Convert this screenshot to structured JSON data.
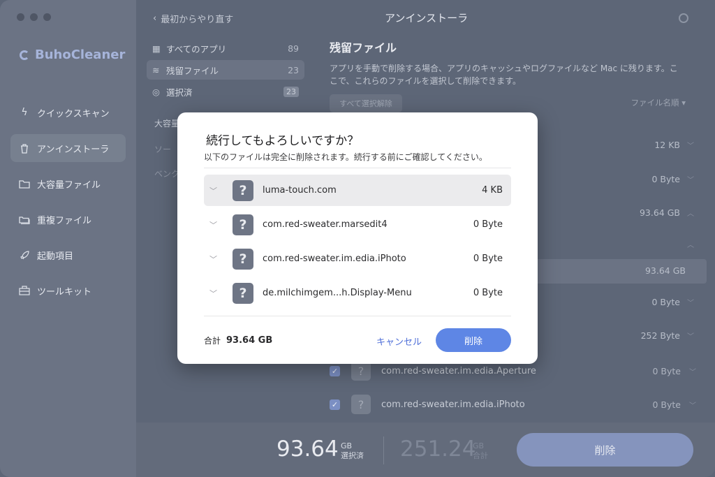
{
  "app": {
    "name": "BuhoCleaner",
    "window_title": "アンインストーラ"
  },
  "sidebar": {
    "items": [
      {
        "label": "クイックスキャン",
        "icon": "bolt-icon"
      },
      {
        "label": "アンインストーラ",
        "icon": "trash-icon",
        "active": true
      },
      {
        "label": "大容量ファイル",
        "icon": "folder-icon"
      },
      {
        "label": "重複ファイル",
        "icon": "folders-icon"
      },
      {
        "label": "起動項目",
        "icon": "rocket-icon"
      },
      {
        "label": "ツールキット",
        "icon": "toolbox-icon"
      }
    ]
  },
  "topbar": {
    "back_label": "最初からやり直す"
  },
  "categories": [
    {
      "label": "すべてのアプリ",
      "count": "89",
      "icon": "grid-icon"
    },
    {
      "label": "残留ファイル",
      "count": "23",
      "icon": "layers-icon",
      "active": true
    },
    {
      "label": "選択済",
      "count": "23",
      "icon": "check-circle-icon"
    }
  ],
  "category_section": {
    "label": "大容量",
    "faded1": "ソー",
    "faded2": "ベンク"
  },
  "right_panel": {
    "title": "残留ファイル",
    "description": "アプリを手動で削除する場合、アプリのキャッシュやログファイルなど Mac に残ります。ここで、これらのファイルを選択して削除できます。",
    "select_all_label": "すべて選択解除",
    "sort_label": "ファイル名順 ▾",
    "size_rows": [
      "12 KB",
      "0 Byte",
      "93.64 GB",
      "",
      "93.64 GB",
      "0 Byte",
      "252 Byte"
    ],
    "list_rows": [
      {
        "name": "com.red-sweater.im.edia.Aperture",
        "size": "0 Byte"
      },
      {
        "name": "com.red-sweater.im.edia.iPhoto",
        "size": "0 Byte"
      }
    ]
  },
  "bottom": {
    "selected_value": "93.64",
    "selected_unit": "GB",
    "selected_label": "選択済",
    "total_value": "251.24",
    "total_unit": "GB",
    "total_label": "合計",
    "delete_label": "削除"
  },
  "dialog": {
    "title": "続行してもよろしいですか？",
    "subtitle": "以下のファイルは完全に削除されます。続行する前にご確認してください。",
    "files": [
      {
        "name": "luma-touch.com",
        "size": "4 KB"
      },
      {
        "name": "com.red-sweater.marsedit4",
        "size": "0 Byte"
      },
      {
        "name": "com.red-sweater.im.edia.iPhoto",
        "size": "0 Byte"
      },
      {
        "name": "de.milchimgem...h.Display-Menu",
        "size": "0 Byte"
      }
    ],
    "total_label": "合計",
    "total_value": "93.64 GB",
    "cancel_label": "キャンセル",
    "delete_label": "削除"
  }
}
